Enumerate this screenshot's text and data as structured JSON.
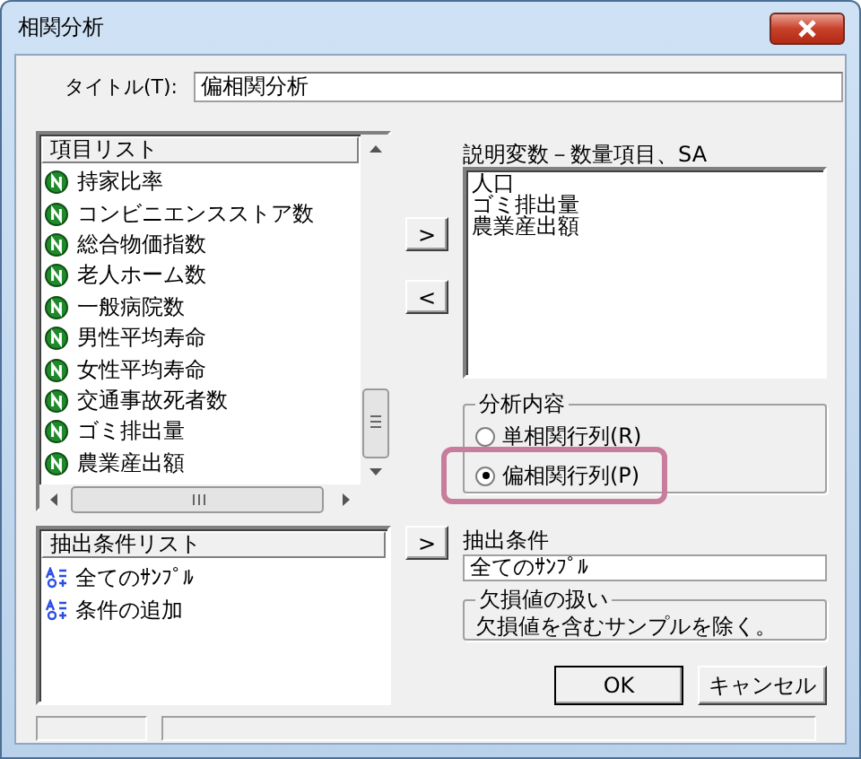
{
  "window": {
    "title": "相関分析"
  },
  "title_field": {
    "label": "タイトル(T):",
    "value": "偏相関分析"
  },
  "item_list": {
    "header": "項目リスト",
    "items": [
      {
        "label": "持家比率"
      },
      {
        "label": "コンビニエンスストア数"
      },
      {
        "label": "総合物価指数"
      },
      {
        "label": "老人ホーム数"
      },
      {
        "label": "一般病院数"
      },
      {
        "label": "男性平均寿命"
      },
      {
        "label": "女性平均寿命"
      },
      {
        "label": "交通事故死者数"
      },
      {
        "label": "ゴミ排出量"
      },
      {
        "label": "農業産出額"
      }
    ]
  },
  "move_buttons": [
    ">",
    "<"
  ],
  "explanatory": {
    "label": "説明変数－数量項目、SA",
    "items": [
      "人口",
      "ゴミ排出量",
      "農業産出額"
    ]
  },
  "analysis": {
    "label": "分析内容",
    "options": [
      {
        "label": "単相関行列(R)",
        "selected": false,
        "highlighted": false
      },
      {
        "label": "偏相関行列(P)",
        "selected": true,
        "highlighted": true
      }
    ]
  },
  "condition_list": {
    "header": "抽出条件リスト",
    "items": [
      "全てのｻﾝﾌﾟﾙ",
      "条件の追加"
    ]
  },
  "condition_button": ">",
  "condition": {
    "label": "抽出条件",
    "value": "全てのｻﾝﾌﾟﾙ"
  },
  "missing": {
    "label": "欠損値の扱い",
    "text": "欠損値を含むサンプルを除く。"
  },
  "buttons": [
    {
      "label": "OK",
      "default": true
    },
    {
      "label": "キャンセル",
      "default": false
    }
  ]
}
